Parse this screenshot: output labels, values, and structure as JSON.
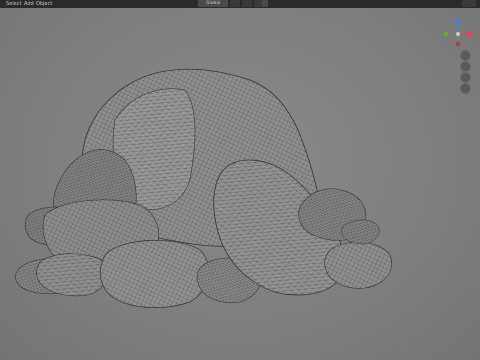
{
  "header": {
    "menus": [
      "Select",
      "Add",
      "Object"
    ],
    "orientation_label": "Global"
  },
  "gizmo": {
    "axes": [
      {
        "name": "X",
        "color": "#e0455a"
      },
      {
        "name": "Y",
        "color": "#6aa83a"
      },
      {
        "name": "Z",
        "color": "#4b7fd6"
      }
    ],
    "nav_icons": [
      "zoom-icon",
      "hand-pan-icon",
      "camera-icon",
      "grid-ortho-icon"
    ]
  },
  "colors": {
    "viewport_bg": "#7e7e7e",
    "header_bg": "#2a2a2a",
    "mesh_fill": "#8f8f8f",
    "wire": "#2a2a2a"
  }
}
